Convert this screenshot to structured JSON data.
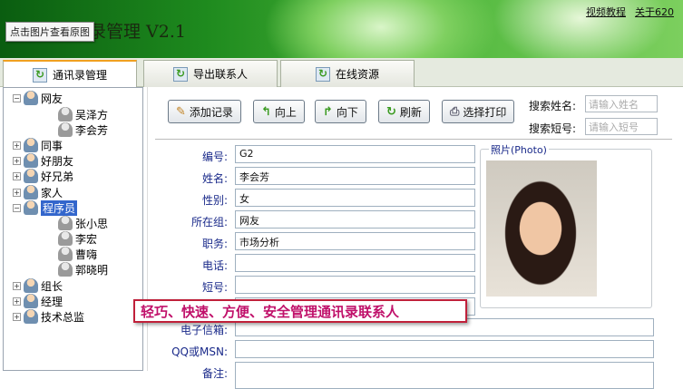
{
  "app": {
    "title": "通讯录管理 V2.1",
    "tooltip": "点击图片查看原图",
    "links": [
      "视频教程",
      "关于620"
    ]
  },
  "tabs": [
    "通讯录管理",
    "导出联系人",
    "在线资源"
  ],
  "tree": [
    {
      "label": "网友",
      "expanded": true,
      "children": [
        "吴泽方",
        "李会芳"
      ]
    },
    {
      "label": "同事"
    },
    {
      "label": "好朋友"
    },
    {
      "label": "好兄弟"
    },
    {
      "label": "家人"
    },
    {
      "label": "程序员",
      "expanded": true,
      "selected": true,
      "children": [
        "张小思",
        "李宏",
        "曹嗨",
        "郭晓明"
      ]
    },
    {
      "label": "组长"
    },
    {
      "label": "经理"
    },
    {
      "label": "技术总监"
    }
  ],
  "toolbar": {
    "add": "添加记录",
    "up": "向上",
    "down": "向下",
    "refresh": "刷新",
    "print": "选择打印"
  },
  "search": {
    "name_label": "搜索姓名:",
    "name_placeholder": "请输入姓名",
    "short_label": "搜索短号:",
    "short_placeholder": "请输入短号"
  },
  "form": {
    "id": {
      "label": "编号:",
      "value": "G2"
    },
    "name": {
      "label": "姓名:",
      "value": "李会芳"
    },
    "gender": {
      "label": "性别:",
      "value": "女"
    },
    "group": {
      "label": "所在组:",
      "value": "网友"
    },
    "job": {
      "label": "职务:",
      "value": "市场分析"
    },
    "phone": {
      "label": "电话:",
      "value": ""
    },
    "short": {
      "label": "短号:",
      "value": ""
    },
    "email": {
      "label": "电子信箱:",
      "value": ""
    },
    "qq": {
      "label": "QQ或MSN:",
      "value": ""
    },
    "note": {
      "label": "备注:",
      "value": ""
    }
  },
  "photo_label": "照片(Photo)",
  "promo": "轻巧、快速、方便、安全管理通讯录联系人"
}
